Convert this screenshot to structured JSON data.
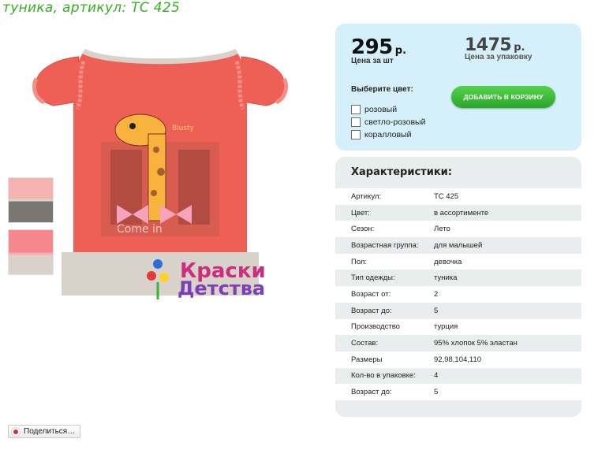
{
  "page": {
    "title": "туника, артикул: ТС 425"
  },
  "gallery": {
    "main_image": "tunic-main-image",
    "thumbnails": [
      "tunic-thumbnail-grey",
      "tunic-thumbnail-pink"
    ]
  },
  "brand": {
    "line1": "Краски",
    "line2": "Детства"
  },
  "tshirt_print": {
    "caption": "Come in",
    "mini": "Blusty"
  },
  "price": {
    "unit_value": "295",
    "unit_currency": "р.",
    "unit_caption": "Цена за шт",
    "pack_value": "1475",
    "pack_currency": "р.",
    "pack_caption": "Цена за упаковку"
  },
  "color_select": {
    "title": "Выберите цвет:",
    "options": [
      "розовый",
      "светло-розовый",
      "коралловый"
    ]
  },
  "add_to_cart": {
    "label": "ДОБАВИТЬ В КОРЗИНУ"
  },
  "characteristics": {
    "title": "Характеристики:",
    "rows": [
      {
        "key": "Артикул:",
        "value": "ТС 425"
      },
      {
        "key": "Цвет:",
        "value": "в ассортименте"
      },
      {
        "key": "Сезон:",
        "value": "Лето"
      },
      {
        "key": "Возрастная группа:",
        "value": "для малышей"
      },
      {
        "key": "Пол:",
        "value": "девочка"
      },
      {
        "key": "Тип одежды:",
        "value": "туника"
      },
      {
        "key": "Возраст от:",
        "value": "2"
      },
      {
        "key": "Возраст до:",
        "value": "5"
      },
      {
        "key": "Производство",
        "value": "турция"
      },
      {
        "key": "Состав:",
        "value": "95% хлопок 5% эластан"
      },
      {
        "key": "Размеры",
        "value": "92,98,104,110"
      },
      {
        "key": "Кол-во в упаковке:",
        "value": "4"
      },
      {
        "key": "Возраст до:",
        "value": "5"
      }
    ]
  },
  "share": {
    "label": "Поделиться…",
    "icon": "share-icon"
  },
  "colors": {
    "title_green": "#35b01e",
    "panel_blue": "#d5f0fb",
    "panel_grey": "#eaeded",
    "button_green": "#3cbc38",
    "tunic_coral": "#ee5f55",
    "tunic_beige": "#d8d2ca"
  }
}
